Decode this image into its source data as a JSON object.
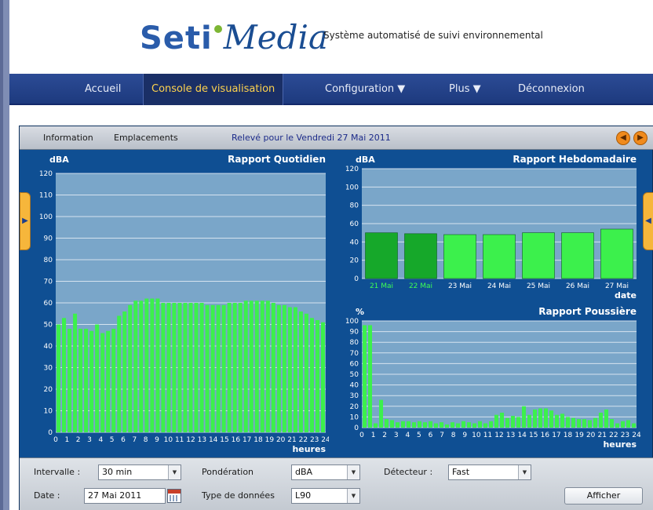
{
  "header": {
    "logo_part1": "Seti",
    "logo_part2": "Media",
    "tagline": "Système automatisé de suivi environnemental"
  },
  "nav": {
    "items": [
      {
        "label": "Accueil"
      },
      {
        "label": "Console de visualisation"
      },
      {
        "label": "Configuration ▼"
      },
      {
        "label": "Plus ▼"
      },
      {
        "label": "Déconnexion"
      }
    ],
    "active_index": 1
  },
  "console": {
    "tabs": [
      "Information",
      "Emplacements"
    ],
    "date_label": "Relevé pour le Vendredi 27 Mai 2011",
    "prev_glyph": "◀",
    "next_glyph": "▶",
    "left_handle_glyph": "▶",
    "right_handle_glyph": "◀"
  },
  "controls": {
    "intervalle_label": "Intervalle :",
    "intervalle_value": "30 min",
    "ponderation_label": "Pondération",
    "ponderation_value": "dBA",
    "detecteur_label": "Détecteur :",
    "detecteur_value": "Fast",
    "date_label": "Date :",
    "date_value": "27 Mai 2011",
    "type_label": "Type de données",
    "type_value": "L90",
    "afficher_label": "Afficher",
    "arrow_glyph": "▼"
  },
  "chart_data": [
    {
      "type": "bar",
      "title": "Rapport Quotidien",
      "ylabel": "dBA",
      "xlabel": "heures",
      "ylim": [
        0,
        120
      ],
      "yticks": [
        "0",
        "10",
        "20",
        "30",
        "40",
        "50",
        "60",
        "70",
        "80",
        "90",
        "100",
        "110",
        "120"
      ],
      "categories": [
        "0",
        "1",
        "2",
        "3",
        "4",
        "5",
        "6",
        "7",
        "8",
        "9",
        "10",
        "11",
        "12",
        "13",
        "14",
        "15",
        "16",
        "17",
        "18",
        "19",
        "20",
        "21",
        "22",
        "23",
        "24"
      ],
      "values": [
        50,
        53,
        48,
        55,
        48,
        48,
        47,
        50,
        46,
        47,
        48,
        54,
        56,
        59,
        61,
        61,
        62,
        62,
        62,
        60,
        60,
        60,
        60,
        60,
        60,
        60,
        60,
        59,
        59,
        59,
        59,
        60,
        60,
        60,
        61,
        61,
        61,
        61,
        61,
        60,
        59,
        59,
        58,
        58,
        56,
        55,
        53,
        52,
        51
      ],
      "color": "#3cf04c"
    },
    {
      "type": "bar",
      "title": "Rapport Hebdomadaire",
      "ylabel": "dBA",
      "xlabel": "date",
      "ylim": [
        0,
        120
      ],
      "yticks": [
        "0",
        "20",
        "40",
        "60",
        "80",
        "100",
        "120"
      ],
      "categories": [
        "21 Mai",
        "22 Mai",
        "23 Mai",
        "24 Mai",
        "25 Mai",
        "26 Mai",
        "27 Mai"
      ],
      "values": [
        50,
        49,
        48,
        48,
        50,
        50,
        54
      ],
      "colors": [
        "#16a82a",
        "#16a82a",
        "#3cf04c",
        "#3cf04c",
        "#3cf04c",
        "#3cf04c",
        "#3cf04c"
      ],
      "highlight_labels": [
        0,
        1
      ]
    },
    {
      "type": "bar",
      "title": "Rapport Poussière",
      "ylabel": "%",
      "xlabel": "heures",
      "ylim": [
        0,
        100
      ],
      "yticks": [
        "0",
        "10",
        "20",
        "30",
        "40",
        "50",
        "60",
        "70",
        "80",
        "90",
        "100"
      ],
      "categories": [
        "0",
        "1",
        "2",
        "3",
        "4",
        "5",
        "6",
        "7",
        "8",
        "9",
        "10",
        "11",
        "12",
        "13",
        "14",
        "15",
        "16",
        "17",
        "18",
        "19",
        "20",
        "21",
        "22",
        "23",
        "24"
      ],
      "values": [
        96,
        96,
        4,
        26,
        8,
        7,
        5,
        6,
        6,
        5,
        6,
        5,
        6,
        4,
        5,
        3,
        5,
        4,
        6,
        5,
        4,
        6,
        4,
        6,
        12,
        14,
        9,
        11,
        10,
        20,
        12,
        17,
        18,
        18,
        16,
        12,
        13,
        10,
        9,
        8,
        8,
        7,
        9,
        14,
        17,
        8,
        4,
        6,
        7,
        4
      ],
      "color": "#3cf04c"
    }
  ]
}
